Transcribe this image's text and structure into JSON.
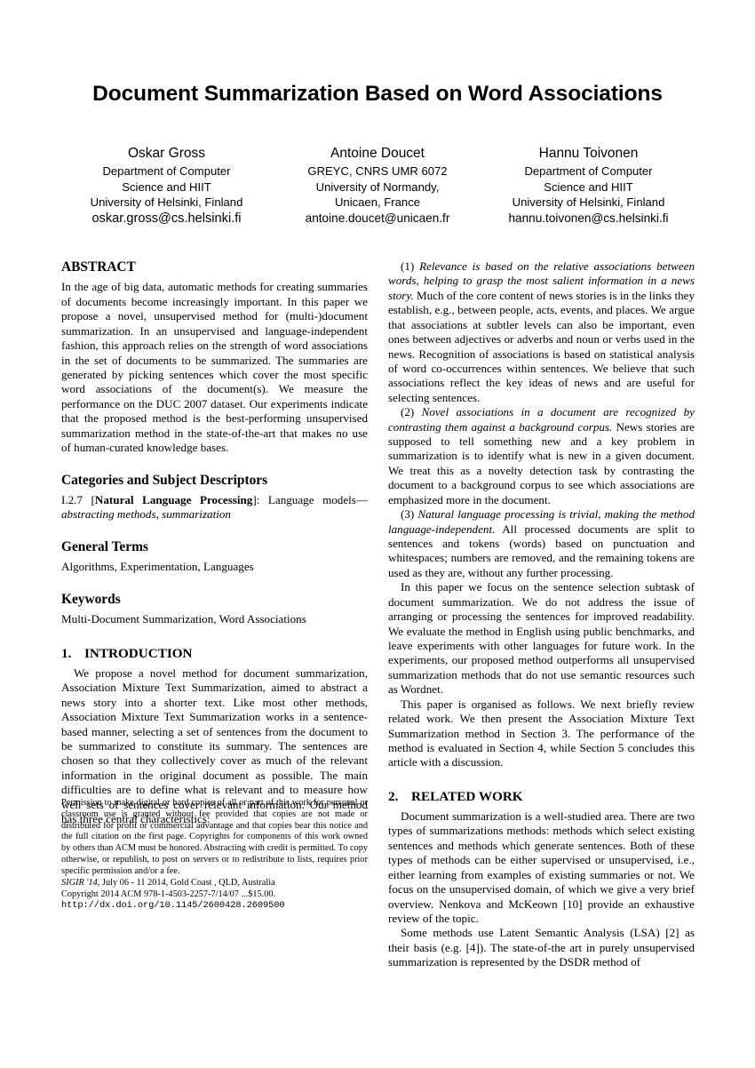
{
  "paper": {
    "title": "Document Summarization Based on Word Associations",
    "authors": [
      {
        "name": "Oskar Gross",
        "affiliation_lines": [
          "Department of Computer",
          "Science and HIIT",
          "University of Helsinki, Finland"
        ],
        "email": "oskar.gross@cs.helsinki.fi"
      },
      {
        "name": "Antoine Doucet",
        "affiliation_lines": [
          "GREYC, CNRS UMR 6072",
          "University of Normandy,",
          "Unicaen, France"
        ],
        "email": "antoine.doucet@unicaen.fr"
      },
      {
        "name": "Hannu Toivonen",
        "affiliation_lines": [
          "Department of Computer",
          "Science and HIIT",
          "University of Helsinki, Finland"
        ],
        "email": "hannu.toivonen@cs.helsinki.fi"
      }
    ]
  },
  "left_column": {
    "abstract_heading": "ABSTRACT",
    "abstract_text": "In the age of big data, automatic methods for creating summaries of documents become increasingly important. In this paper we propose a novel, unsupervised method for (multi-)document summarization. In an unsupervised and language-independent fashion, this approach relies on the strength of word associations in the set of documents to be summarized. The summaries are generated by picking sentences which cover the most specific word associations of the document(s). We measure the performance on the DUC 2007 dataset. Our experiments indicate that the proposed method is the best-performing unsupervised summarization method in the state-of-the-art that makes no use of human-curated knowledge bases.",
    "categories_heading": "Categories and Subject Descriptors",
    "categories_prefix": "I.2.7 [",
    "categories_bold": "Natural Language Processing",
    "categories_mid": "]: Language models—",
    "categories_italic": "abstracting methods, summarization",
    "general_terms_heading": "General Terms",
    "general_terms_text": "Algorithms, Experimentation, Languages",
    "keywords_heading": "Keywords",
    "keywords_text": "Multi-Document Summarization, Word Associations",
    "intro_number": "1.",
    "intro_heading": "INTRODUCTION",
    "intro_text": "We propose a novel method for document summarization, Association Mixture Text Summarization, aimed to abstract a news story into a shorter text. Like most other methods, Association Mixture Text Summarization works in a sentence-based manner, selecting a set of sentences from the document to be summarized to constitute its summary. The sentences are chosen so that they collectively cover as much of the relevant information in the original document as possible. The main difficulties are to define what is relevant and to measure how well sets of sentences cover relevant information. Our method has three central characteristics:"
  },
  "copyright": {
    "permission_text": "Permission to make digital or hard copies of all or part of this work for personal or classroom use is granted without fee provided that copies are not made or distributed for profit or commercial advantage and that copies bear this notice and the full citation on the first page. Copyrights for components of this work owned by others than ACM must be honored. Abstracting with credit is permitted. To copy otherwise, or republish, to post on servers or to redistribute to lists, requires prior specific permission and/or a fee.",
    "venue_italic": "SIGIR '14,",
    "venue_rest": " July 06 - 11 2014, Gold Coast , QLD, Australia",
    "copyright_line": "Copyright 2014 ACM 978-1-4503-2257-7/14/07 ...$15.00.",
    "doi": "http://dx.doi.org/10.1145/2600428.2609500"
  },
  "right_column": {
    "point1_num": "(1) ",
    "point1_italic": "Relevance is based on the relative associations between words, helping to grasp the most salient information in a news story.",
    "point1_rest": " Much of the core content of news stories is in the links they establish, e.g., between people, acts, events, and places. We argue that associations at subtler levels can also be important, even ones between adjectives or adverbs and noun or verbs used in the news. Recognition of associations is based on statistical analysis of word co-occurrences within sentences. We believe that such associations reflect the key ideas of news and are useful for selecting sentences.",
    "point2_num": "(2) ",
    "point2_italic": "Novel associations in a document are recognized by contrasting them against a background corpus.",
    "point2_rest": " News stories are supposed to tell something new and a key problem in summarization is to identify what is new in a given document. We treat this as a novelty detection task by contrasting the document to a background corpus to see which associations are emphasized more in the document.",
    "point3_num": "(3) ",
    "point3_italic": "Natural language processing is trivial, making the method language-independent.",
    "point3_rest": " All processed documents are split to sentences and tokens (words) based on punctuation and whitespaces; numbers are removed, and the remaining tokens are used as they are, without any further processing.",
    "para4": "In this paper we focus on the sentence selection subtask of document summarization. We do not address the issue of arranging or processing the sentences for improved readability. We evaluate the method in English using public benchmarks, and leave experiments with other languages for future work. In the experiments, our proposed method outperforms all unsupervised summarization methods that do not use semantic resources such as Wordnet.",
    "para5": "This paper is organised as follows. We next briefly review related work. We then present the Association Mixture Text Summarization method in Section 3. The performance of the method is evaluated in Section 4, while Section 5 concludes this article with a discussion.",
    "related_number": "2.",
    "related_heading": "RELATED WORK",
    "related_para1": "Document summarization is a well-studied area. There are two types of summarizations methods: methods which select existing sentences and methods which generate sentences. Both of these types of methods can be either supervised or unsupervised, i.e., either learning from examples of existing summaries or not. We focus on the unsupervised domain, of which we give a very brief overview. Nenkova and McKeown [10] provide an exhaustive review of the topic.",
    "related_para2": "Some methods use Latent Semantic Analysis (LSA) [2] as their basis (e.g. [4]). The state-of-the art in purely unsupervised summarization is represented by the DSDR method of"
  }
}
